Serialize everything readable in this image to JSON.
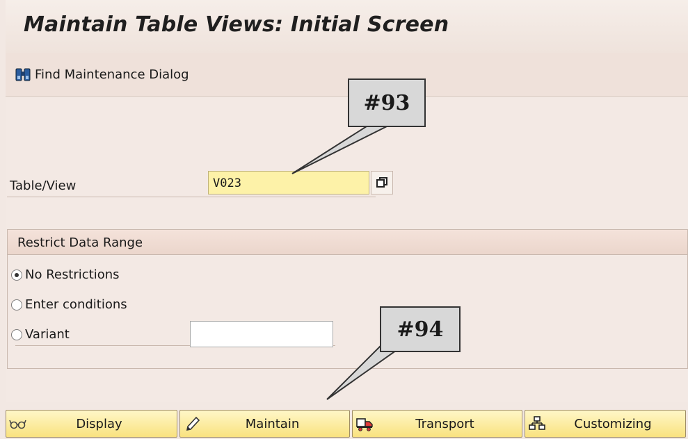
{
  "window": {
    "title": "Maintain Table Views: Initial Screen"
  },
  "toolbar": {
    "find_label": "Find Maintenance Dialog",
    "find_icon": "binoculars-icon"
  },
  "table_view": {
    "label": "Table/View",
    "value": "V023",
    "help_icon": "value-help-icon"
  },
  "restrict": {
    "title": "Restrict Data Range",
    "options": [
      {
        "label": "No Restrictions",
        "selected": true
      },
      {
        "label": "Enter conditions",
        "selected": false
      },
      {
        "label": "Variant",
        "selected": false
      }
    ],
    "variant_value": ""
  },
  "callouts": {
    "first": "#93",
    "second": "#94"
  },
  "buttons": [
    {
      "label": "Display",
      "icon": "glasses-icon"
    },
    {
      "label": "Maintain",
      "icon": "pencil-icon"
    },
    {
      "label": "Transport",
      "icon": "truck-icon"
    },
    {
      "label": "Customizing",
      "icon": "hierarchy-icon"
    }
  ],
  "colors": {
    "background": "#f3e9e4",
    "input_required": "#fdf2a8",
    "button_fill": "#f9e27f",
    "callout_fill": "#d8d8d8"
  }
}
